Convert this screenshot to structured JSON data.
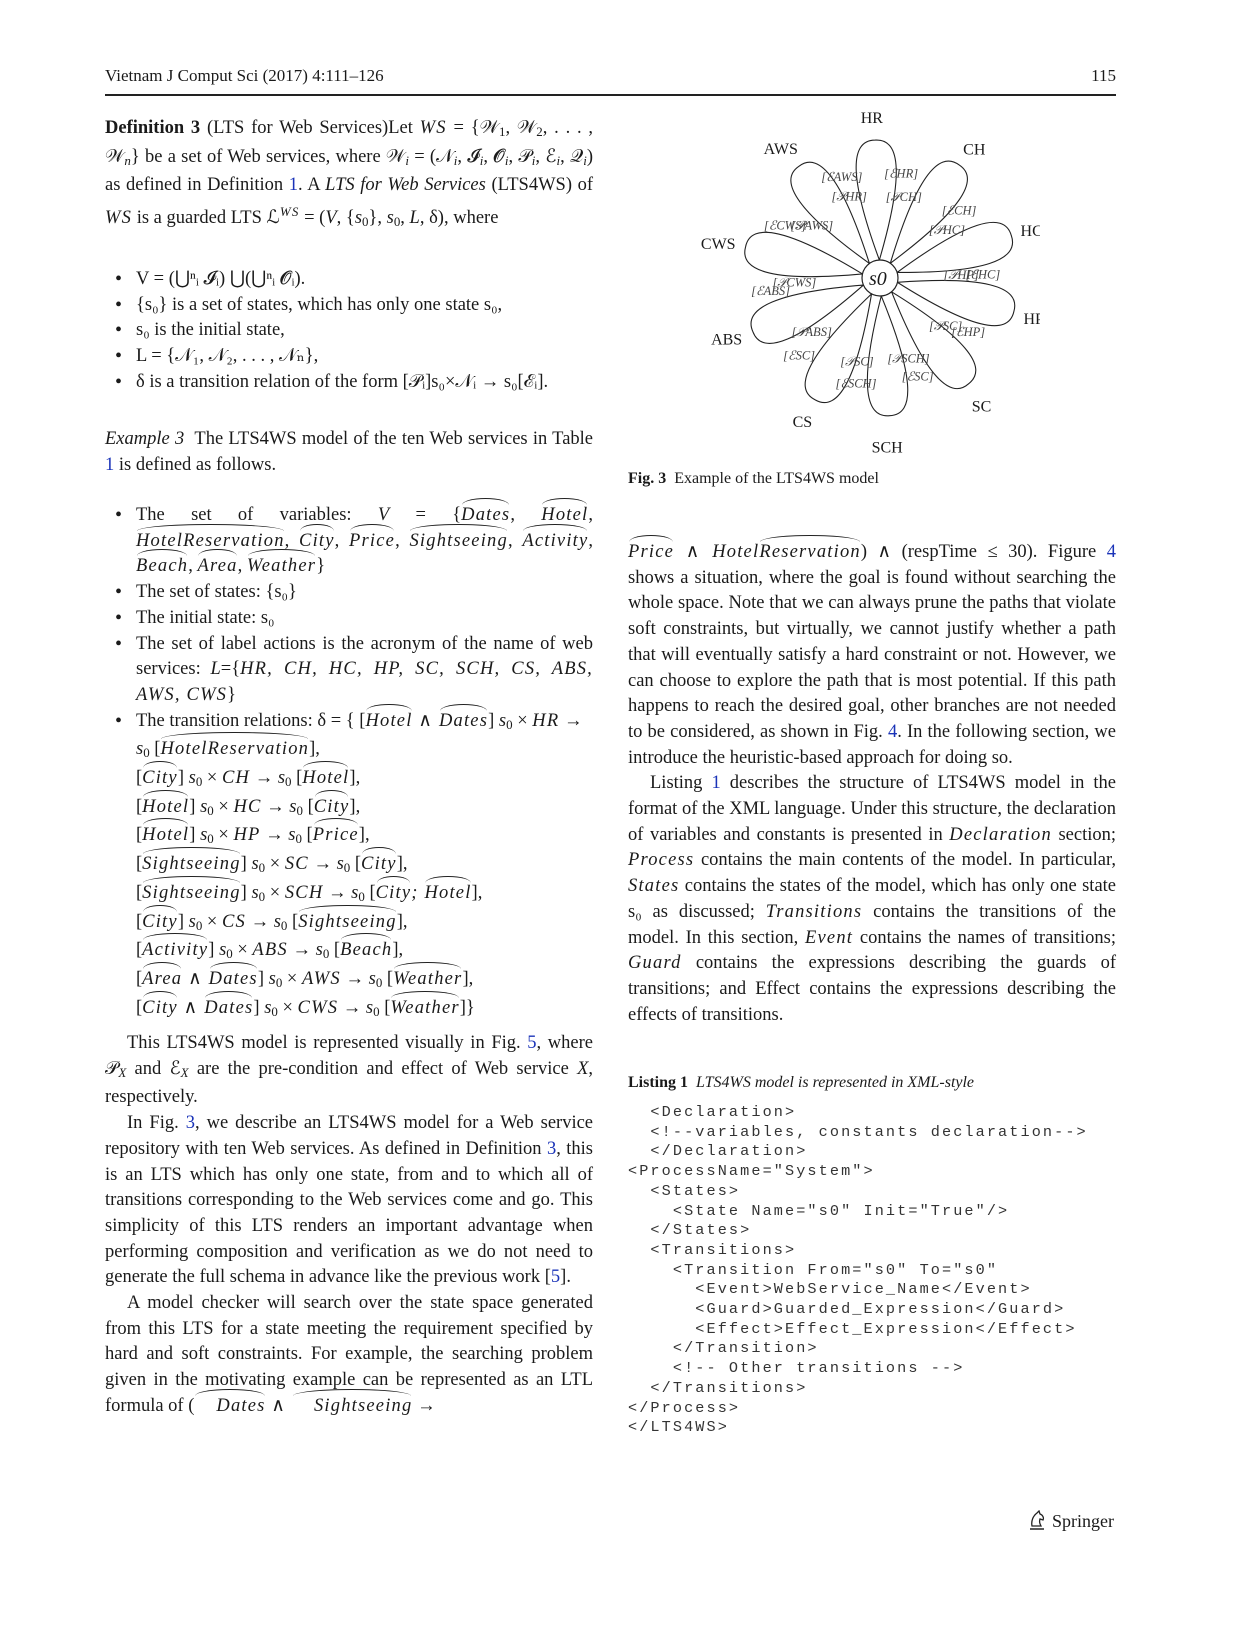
{
  "header": {
    "journal": "Vietnam J Comput Sci (2017) 4:111–126",
    "page_number": "115"
  },
  "left_column": {
    "definition": {
      "label": "Definition 3",
      "title": "(LTS for Web Services)Let",
      "text_1": "be a set of Web services, where",
      "text_2": "as defined in Definition",
      "def_ref": "1",
      "text_3": ". A",
      "term": "LTS for Web Services",
      "text_4": "(LTS4WS) of",
      "text_5": "is a guarded LTS",
      "text_6": ", where",
      "bullets": [
        "V = (⋃ⁿᵢ 𝓘ᵢ) ⋃(⋃ⁿᵢ 𝓞ᵢ).",
        "{s₀} is a set of states, which has only one state s₀,",
        "s₀ is the initial state,",
        "L = {𝒩₁, 𝒩₂, . . . , 𝒩ₙ},",
        "δ is a transition relation of the form [𝒫ᵢ]s₀×𝒩ᵢ → s₀[ℰᵢ]."
      ]
    },
    "example": {
      "label": "Example 3",
      "text": "The LTS4WS model of the ten Web services in Table",
      "table_ref": "1",
      "text_end": "is defined as follows.",
      "variables_intro": "The set of variables:",
      "variables": [
        "Dates",
        "Hotel",
        "HotelReservation",
        "City",
        "Price",
        "Sightseeing",
        "Activity",
        "Beach",
        "Area",
        "Weather"
      ],
      "states": "The set of states: {s₀}",
      "initial_state": "The initial state: s₀",
      "labels_intro": "The set of label actions is the acronym of the name of web services:",
      "labels": [
        "HR",
        "CH",
        "HC",
        "HP",
        "SC",
        "SCH",
        "CS",
        "ABS",
        "AWS",
        "CWS"
      ],
      "transitions_intro": "The transition relations: δ = {",
      "transitions": [
        {
          "guard": "Hotel ∧ Dates",
          "service": "HR",
          "effect": "HotelReservation"
        },
        {
          "guard": "City",
          "service": "CH",
          "effect": "Hotel"
        },
        {
          "guard": "Hotel",
          "service": "HC",
          "effect": "City"
        },
        {
          "guard": "Hotel",
          "service": "HP",
          "effect": "Price"
        },
        {
          "guard": "Sightseeing",
          "service": "SC",
          "effect": "City"
        },
        {
          "guard": "Sightseeing",
          "service": "SCH",
          "effect": "City; Hotel"
        },
        {
          "guard": "City",
          "service": "CS",
          "effect": "Sightseeing"
        },
        {
          "guard": "Activity",
          "service": "ABS",
          "effect": "Beach"
        },
        {
          "guard": "Area ∧ Dates",
          "service": "AWS",
          "effect": "Weather"
        },
        {
          "guard": "City ∧ Dates",
          "service": "CWS",
          "effect": "Weather"
        }
      ]
    },
    "para1": {
      "a": "This LTS4WS model is represented visually in Fig.",
      "fig_ref": "5",
      "b": ", where 𝒫",
      "c": "and ℰ",
      "d": "are the pre-condition and effect of Web service",
      "e": ", respectively."
    },
    "para2": {
      "a": "In Fig.",
      "fig_ref": "3",
      "b": ", we describe an LTS4WS model for a Web service repository with ten Web services. As defined in Definition",
      "def_ref": "3",
      "c": ", this is an LTS which has only one state, from and to which all of transitions corresponding to the Web services come and go. This simplicity of this LTS renders an important advantage when performing composition and verification as we do not need to generate the full schema in advance like the previous work",
      "cite": "5",
      "d": "."
    },
    "para3": "A model checker will search over the state space generated from this LTS for a state meeting the requirement specified by hard and soft constraints. For example, the searching problem given in the motivating example can be represented as an LTL formula of ("
  },
  "figure": {
    "center_state": "s0",
    "services": [
      {
        "name": "HR",
        "pre": "HR",
        "eff": "HR"
      },
      {
        "name": "CH",
        "pre": "CH",
        "eff": "CH"
      },
      {
        "name": "HC",
        "pre": "HC",
        "eff": "HC"
      },
      {
        "name": "HP",
        "pre": "HP",
        "eff": "HP"
      },
      {
        "name": "SC",
        "pre": "SC",
        "eff": "SC"
      },
      {
        "name": "SCH",
        "pre": "SCH",
        "eff": "SCH"
      },
      {
        "name": "CS",
        "pre": "SC",
        "eff": "SC"
      },
      {
        "name": "ABS",
        "pre": "ABS",
        "eff": "ABS"
      },
      {
        "name": "CWS",
        "pre": "CWS",
        "eff": "CWS"
      },
      {
        "name": "AWS",
        "pre": "AWS",
        "eff": "AWS"
      }
    ],
    "caption_label": "Fig. 3",
    "caption_text": "Example of the LTS4WS model"
  },
  "right_column": {
    "cont_line_end": ") ∧ (respTime ≤ 30). Figure",
    "fig_ref": "4",
    "para1": "shows a situation, where the goal is found without searching the whole space. Note that we can always prune the paths that violate soft constraints, but virtually, we cannot justify whether a path that will eventually satisfy a hard constraint or not. However, we can choose to explore the path that is most potential. If this path happens to reach the desired goal, other branches are not needed to be considered, as shown in Fig.",
    "para1_ref": "4",
    "para1_end": ". In the following section, we introduce the heuristic-based approach for doing so.",
    "para2": {
      "a": "Listing",
      "ref": "1",
      "b": "describes the structure of LTS4WS model in the format of the XML language. Under this structure, the declaration of variables and constants is presented in",
      "declaration": "Declaration",
      "c": "section;",
      "process": "Process",
      "d": "contains the main contents of the model. In particular,",
      "states": "States",
      "e": "contains the states of the model, which has only one state s₀ as discussed;",
      "transitions": "Transitions",
      "f": "contains the transitions of the model. In this section,",
      "event": "Event",
      "g": "contains the names of transitions;",
      "guard": "Guard",
      "h": "contains the expressions describing the guards of transitions; and Effect contains the expressions describing the effects of transitions."
    },
    "listing": {
      "label": "Listing 1",
      "caption": "LTS4WS model is represented in XML-style",
      "lines": [
        "  <Declaration>",
        "  <!--variables, constants declaration-->",
        "  </Declaration>",
        "<ProcessName=\"System\">",
        "  <States>",
        "    <State Name=\"s0\" Init=\"True\"/>",
        "  </States>",
        "  <Transitions>",
        "    <Transition From=\"s0\" To=\"s0\"",
        "      <Event>WebService_Name</Event>",
        "      <Guard>Guarded_Expression</Guard>",
        "      <Effect>Effect_Expression</Effect>",
        "    </Transition>",
        "    <!-- Other transitions -->",
        "  </Transitions>",
        "</Process>",
        "</LTS4WS>"
      ]
    }
  },
  "footer": {
    "publisher": "Springer"
  }
}
